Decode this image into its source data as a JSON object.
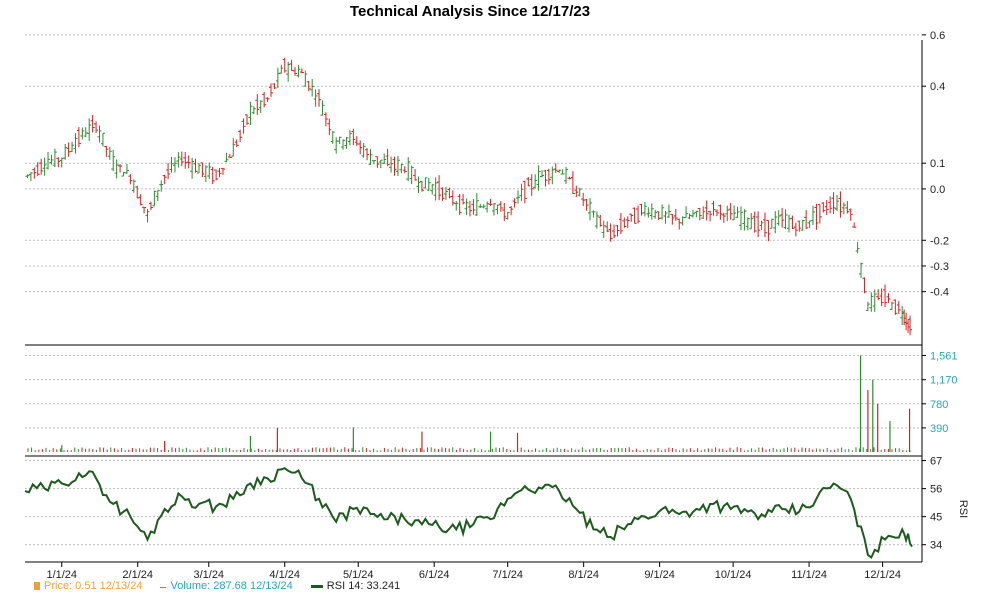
{
  "colors": {
    "up": "#2e8b2e",
    "down": "#d62020",
    "volume_axis": "#2aa6b7",
    "rsi_line": "#1e5a1e",
    "price_legend": "#f0a03a"
  },
  "chart_data": {
    "type": "line",
    "title": "Technical Analysis Since 12/17/23",
    "x_ticks": [
      "1/1/24",
      "2/1/24",
      "3/1/24",
      "4/1/24",
      "5/1/24",
      "6/1/24",
      "7/1/24",
      "8/1/24",
      "9/1/24",
      "10/1/24",
      "11/1/24",
      "12/1/24"
    ],
    "x_range": [
      "12/17/23",
      "12/13/24"
    ],
    "grid": true,
    "price_panel": {
      "ylim": [
        -0.6,
        0.65
      ],
      "yticks": [
        0.6,
        0.4,
        0.1,
        0.0,
        -0.2,
        -0.3,
        -0.4
      ],
      "ytick_labels": [
        "0.6",
        "0.4",
        "0.1",
        "0.0",
        "-0.2",
        "-0.3",
        "-0.4"
      ],
      "weekly_close": [
        {
          "date": "12/18/23",
          "value": 0.05
        },
        {
          "date": "12/25/23",
          "value": 0.1
        },
        {
          "date": "1/1/24",
          "value": 0.12
        },
        {
          "date": "1/8/24",
          "value": 0.2
        },
        {
          "date": "1/15/24",
          "value": 0.25
        },
        {
          "date": "1/22/24",
          "value": 0.1
        },
        {
          "date": "1/29/24",
          "value": 0.05
        },
        {
          "date": "2/5/24",
          "value": -0.1
        },
        {
          "date": "2/12/24",
          "value": 0.05
        },
        {
          "date": "2/19/24",
          "value": 0.12
        },
        {
          "date": "2/26/24",
          "value": 0.08
        },
        {
          "date": "3/4/24",
          "value": 0.05
        },
        {
          "date": "3/11/24",
          "value": 0.15
        },
        {
          "date": "3/18/24",
          "value": 0.3
        },
        {
          "date": "3/25/24",
          "value": 0.35
        },
        {
          "date": "4/1/24",
          "value": 0.48
        },
        {
          "date": "4/8/24",
          "value": 0.45
        },
        {
          "date": "4/15/24",
          "value": 0.35
        },
        {
          "date": "4/22/24",
          "value": 0.18
        },
        {
          "date": "4/29/24",
          "value": 0.2
        },
        {
          "date": "5/6/24",
          "value": 0.12
        },
        {
          "date": "5/13/24",
          "value": 0.1
        },
        {
          "date": "5/20/24",
          "value": 0.08
        },
        {
          "date": "5/27/24",
          "value": 0.02
        },
        {
          "date": "6/3/24",
          "value": 0.0
        },
        {
          "date": "6/10/24",
          "value": -0.05
        },
        {
          "date": "6/17/24",
          "value": -0.08
        },
        {
          "date": "6/24/24",
          "value": -0.05
        },
        {
          "date": "7/1/24",
          "value": -0.1
        },
        {
          "date": "7/8/24",
          "value": 0.0
        },
        {
          "date": "7/15/24",
          "value": 0.05
        },
        {
          "date": "7/22/24",
          "value": 0.08
        },
        {
          "date": "7/29/24",
          "value": 0.0
        },
        {
          "date": "8/5/24",
          "value": -0.1
        },
        {
          "date": "8/12/24",
          "value": -0.18
        },
        {
          "date": "8/19/24",
          "value": -0.12
        },
        {
          "date": "8/26/24",
          "value": -0.08
        },
        {
          "date": "9/2/24",
          "value": -0.1
        },
        {
          "date": "9/9/24",
          "value": -0.12
        },
        {
          "date": "9/16/24",
          "value": -0.1
        },
        {
          "date": "9/23/24",
          "value": -0.08
        },
        {
          "date": "9/30/24",
          "value": -0.1
        },
        {
          "date": "10/7/24",
          "value": -0.12
        },
        {
          "date": "10/14/24",
          "value": -0.15
        },
        {
          "date": "10/21/24",
          "value": -0.12
        },
        {
          "date": "10/28/24",
          "value": -0.15
        },
        {
          "date": "11/4/24",
          "value": -0.1
        },
        {
          "date": "11/11/24",
          "value": -0.05
        },
        {
          "date": "11/18/24",
          "value": -0.08
        },
        {
          "date": "11/25/24",
          "value": -0.45
        },
        {
          "date": "12/2/24",
          "value": -0.42
        },
        {
          "date": "12/9/24",
          "value": -0.48
        },
        {
          "date": "12/13/24",
          "value": -0.55
        }
      ]
    },
    "volume_panel": {
      "ylim": [
        0,
        1650
      ],
      "yticks": [
        1561,
        1170,
        780,
        390
      ],
      "ytick_labels": [
        "1,561",
        "1,170",
        "780",
        "390"
      ],
      "spikes": [
        {
          "date": "1/1/24",
          "value": 110
        },
        {
          "date": "2/12/24",
          "value": 180
        },
        {
          "date": "3/18/24",
          "value": 260
        },
        {
          "date": "3/29/24",
          "value": 390
        },
        {
          "date": "4/29/24",
          "value": 400
        },
        {
          "date": "5/27/24",
          "value": 330
        },
        {
          "date": "6/24/24",
          "value": 330
        },
        {
          "date": "7/5/24",
          "value": 310
        },
        {
          "date": "11/22/24",
          "value": 1561
        },
        {
          "date": "11/25/24",
          "value": 1000
        },
        {
          "date": "11/27/24",
          "value": 1170
        },
        {
          "date": "11/29/24",
          "value": 780
        },
        {
          "date": "12/4/24",
          "value": 500
        },
        {
          "date": "12/12/24",
          "value": 700
        }
      ],
      "baseline": 60
    },
    "rsi_panel": {
      "ylim": [
        28,
        68
      ],
      "yticks": [
        67,
        56,
        45,
        34
      ],
      "ytick_labels": [
        "67",
        "56",
        "45",
        "34"
      ],
      "axis_label": "RSI",
      "series": [
        {
          "date": "12/17/23",
          "value": 55
        },
        {
          "date": "12/25/23",
          "value": 56
        },
        {
          "date": "1/1/24",
          "value": 58
        },
        {
          "date": "1/8/24",
          "value": 62
        },
        {
          "date": "1/15/24",
          "value": 60
        },
        {
          "date": "1/22/24",
          "value": 50
        },
        {
          "date": "1/29/24",
          "value": 45
        },
        {
          "date": "2/5/24",
          "value": 36
        },
        {
          "date": "2/12/24",
          "value": 48
        },
        {
          "date": "2/19/24",
          "value": 53
        },
        {
          "date": "2/26/24",
          "value": 50
        },
        {
          "date": "3/4/24",
          "value": 49
        },
        {
          "date": "3/11/24",
          "value": 52
        },
        {
          "date": "3/18/24",
          "value": 58
        },
        {
          "date": "3/25/24",
          "value": 60
        },
        {
          "date": "4/1/24",
          "value": 64
        },
        {
          "date": "4/8/24",
          "value": 60
        },
        {
          "date": "4/15/24",
          "value": 52
        },
        {
          "date": "4/22/24",
          "value": 43
        },
        {
          "date": "4/29/24",
          "value": 48
        },
        {
          "date": "5/6/24",
          "value": 46
        },
        {
          "date": "5/13/24",
          "value": 44
        },
        {
          "date": "5/20/24",
          "value": 44
        },
        {
          "date": "5/27/24",
          "value": 42
        },
        {
          "date": "6/3/24",
          "value": 41
        },
        {
          "date": "6/10/24",
          "value": 40
        },
        {
          "date": "6/17/24",
          "value": 42
        },
        {
          "date": "6/24/24",
          "value": 44
        },
        {
          "date": "7/1/24",
          "value": 52
        },
        {
          "date": "7/8/24",
          "value": 57
        },
        {
          "date": "7/15/24",
          "value": 56
        },
        {
          "date": "7/22/24",
          "value": 55
        },
        {
          "date": "7/29/24",
          "value": 48
        },
        {
          "date": "8/5/24",
          "value": 40
        },
        {
          "date": "8/12/24",
          "value": 37
        },
        {
          "date": "8/19/24",
          "value": 42
        },
        {
          "date": "8/26/24",
          "value": 45
        },
        {
          "date": "9/2/24",
          "value": 48
        },
        {
          "date": "9/9/24",
          "value": 46
        },
        {
          "date": "9/16/24",
          "value": 48
        },
        {
          "date": "9/23/24",
          "value": 50
        },
        {
          "date": "9/30/24",
          "value": 48
        },
        {
          "date": "10/7/24",
          "value": 47
        },
        {
          "date": "10/14/24",
          "value": 45
        },
        {
          "date": "10/21/24",
          "value": 48
        },
        {
          "date": "10/28/24",
          "value": 47
        },
        {
          "date": "11/4/24",
          "value": 52
        },
        {
          "date": "11/11/24",
          "value": 58
        },
        {
          "date": "11/18/24",
          "value": 52
        },
        {
          "date": "11/25/24",
          "value": 30
        },
        {
          "date": "12/2/24",
          "value": 36
        },
        {
          "date": "12/9/24",
          "value": 40
        },
        {
          "date": "12/13/24",
          "value": 33.241
        }
      ]
    },
    "legend": [
      {
        "label": "Price: 0.51  12/13/24"
      },
      {
        "label": "Volume: 287.68  12/13/24"
      },
      {
        "label": "RSI 14: 33.241"
      }
    ]
  }
}
